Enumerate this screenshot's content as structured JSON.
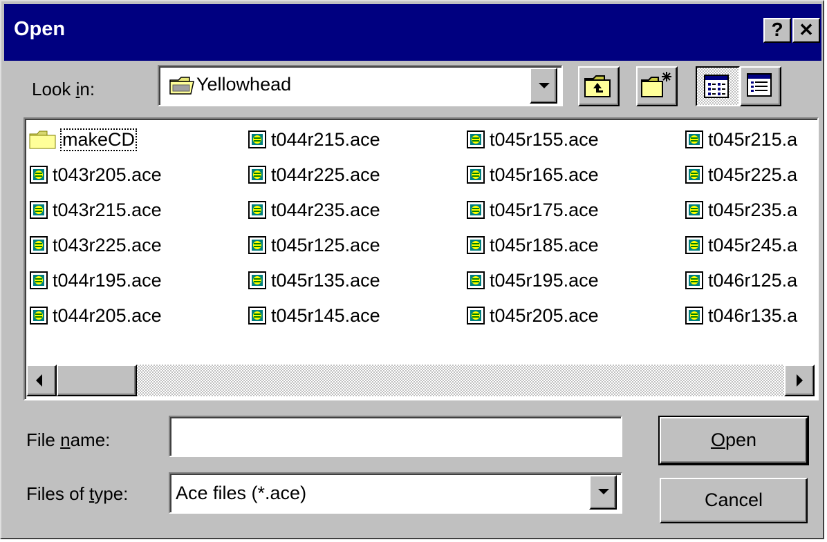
{
  "window": {
    "title": "Open",
    "help_button": "?",
    "close_button": "✕"
  },
  "look_in": {
    "label_pre": "Look ",
    "label_key": "i",
    "label_post": "n:",
    "value": "Yellowhead"
  },
  "toolbar": {
    "up_folder_icon": "folder-up-icon",
    "new_folder_icon": "new-folder-icon",
    "list_view_icon": "list-view-icon",
    "details_view_icon": "details-view-icon"
  },
  "files": {
    "columns": [
      [
        "makeCD",
        "t043r205.ace",
        "t043r215.ace",
        "t043r225.ace",
        "t044r195.ace",
        "t044r205.ace"
      ],
      [
        "t044r215.ace",
        "t044r225.ace",
        "t044r235.ace",
        "t045r125.ace",
        "t045r135.ace",
        "t045r145.ace"
      ],
      [
        "t045r155.ace",
        "t045r165.ace",
        "t045r175.ace",
        "t045r185.ace",
        "t045r195.ace",
        "t045r205.ace"
      ],
      [
        "t045r215.a",
        "t045r225.a",
        "t045r235.a",
        "t045r245.a",
        "t046r125.a",
        "t046r135.a"
      ]
    ],
    "selected": "makeCD"
  },
  "file_name": {
    "label_pre": "File ",
    "label_key": "n",
    "label_post": "ame:",
    "value": ""
  },
  "file_type": {
    "label_pre": "Files of ",
    "label_key": "t",
    "label_post": "ype:",
    "value": "Ace files (*.ace)"
  },
  "buttons": {
    "open_key": "O",
    "open_rest": "pen",
    "cancel": "Cancel"
  },
  "colors": {
    "titlebar": "#000080",
    "face": "#c0c0c0",
    "selection_border": "#000000"
  }
}
